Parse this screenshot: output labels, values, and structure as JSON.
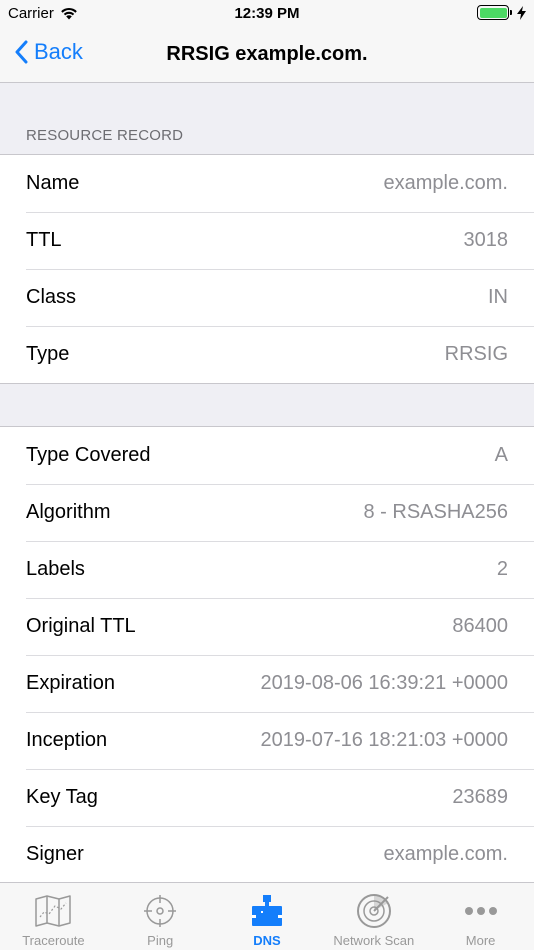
{
  "status_bar": {
    "carrier": "Carrier",
    "time": "12:39 PM"
  },
  "nav": {
    "back_label": "Back",
    "title": "RRSIG example.com."
  },
  "resource_record": {
    "header": "RESOURCE RECORD",
    "rows": [
      {
        "label": "Name",
        "value": "example.com."
      },
      {
        "label": "TTL",
        "value": "3018"
      },
      {
        "label": "Class",
        "value": "IN"
      },
      {
        "label": "Type",
        "value": "RRSIG"
      }
    ]
  },
  "rrsig": {
    "rows": [
      {
        "label": "Type Covered",
        "value": "A"
      },
      {
        "label": "Algorithm",
        "value": "8 - RSASHA256"
      },
      {
        "label": "Labels",
        "value": "2"
      },
      {
        "label": "Original TTL",
        "value": "86400"
      },
      {
        "label": "Expiration",
        "value": "2019-08-06 16:39:21 +0000"
      },
      {
        "label": "Inception",
        "value": "2019-07-16 18:21:03 +0000"
      },
      {
        "label": "Key Tag",
        "value": "23689"
      },
      {
        "label": "Signer",
        "value": "example.com."
      }
    ]
  },
  "tabs": [
    {
      "label": "Traceroute",
      "icon": "map-icon"
    },
    {
      "label": "Ping",
      "icon": "crosshair-icon"
    },
    {
      "label": "DNS",
      "icon": "dns-icon",
      "active": true
    },
    {
      "label": "Network Scan",
      "icon": "radar-icon"
    },
    {
      "label": "More",
      "icon": "more-dots-icon"
    }
  ],
  "colors": {
    "accent": "#147efb",
    "battery": "#4cd964",
    "secondary_text": "#8e8e93"
  }
}
